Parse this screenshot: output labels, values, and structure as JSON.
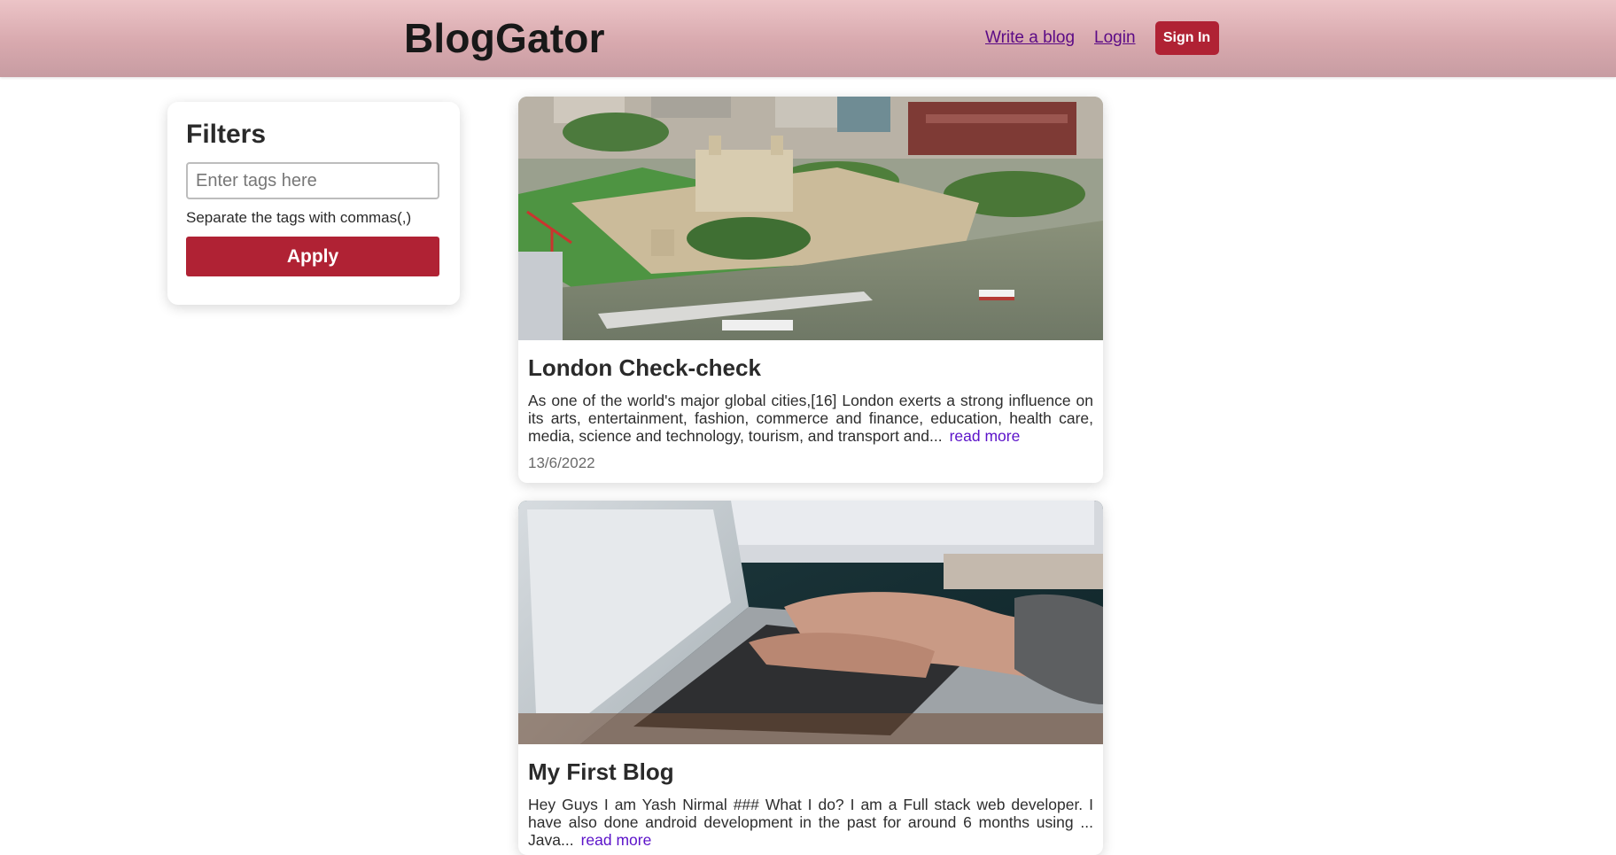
{
  "header": {
    "brand": "BlogGator",
    "nav_write": "Write a blog",
    "nav_login": "Login",
    "signin_label": "Sign In",
    "accent_color": "#b02234"
  },
  "filters": {
    "title": "Filters",
    "input_placeholder": "Enter tags here",
    "input_value": "",
    "hint": "Separate the tags with commas(,)",
    "apply_label": "Apply"
  },
  "posts": [
    {
      "title": "London Check-check",
      "excerpt": "As one of the world's major global cities,[16] London exerts a strong influence on its arts, entertainment, fashion, commerce and finance, education, health care, media, science and technology, tourism, and transport and...",
      "read_more": "read more",
      "date": "13/6/2022",
      "image_icon": "aerial-city-river-photo"
    },
    {
      "title": "My First Blog",
      "excerpt": "Hey Guys I am Yash Nirmal ### What I do? I am a Full stack web developer. I have also done android development in the past for around 6 months using ... Java...",
      "read_more": "read more",
      "date": "",
      "image_icon": "laptop-typing-photo"
    }
  ]
}
